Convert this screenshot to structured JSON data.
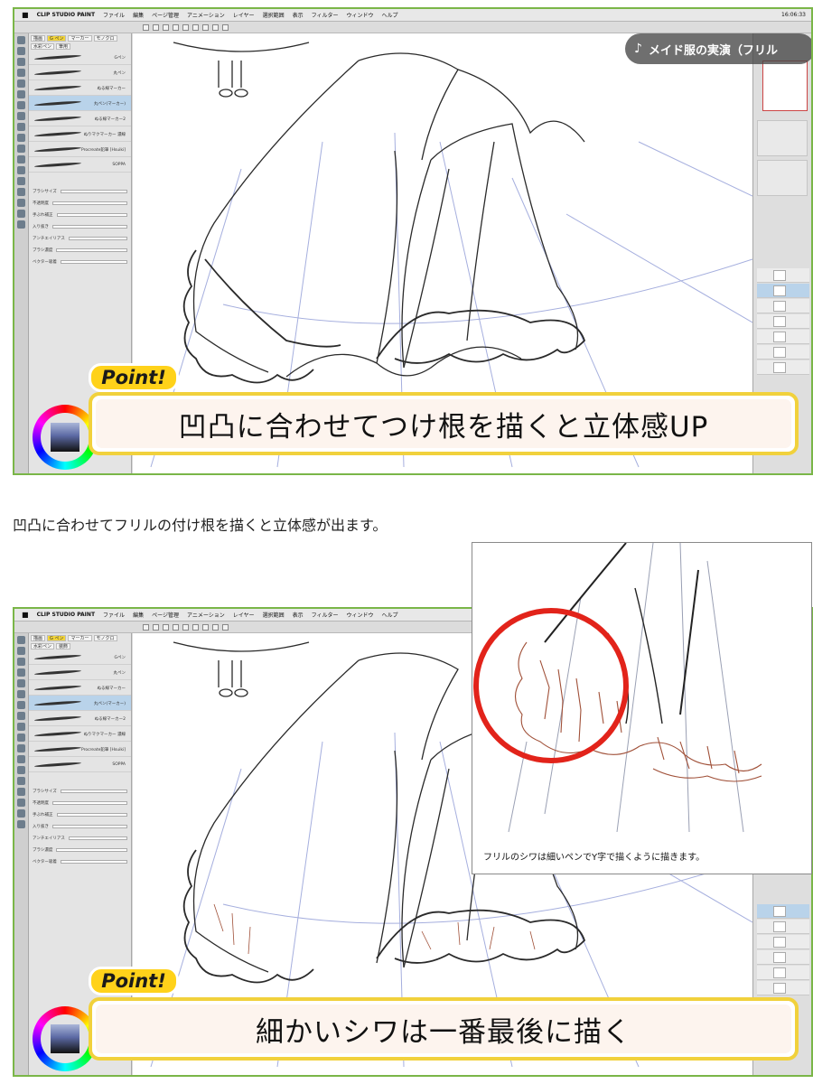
{
  "app": {
    "name": "CLIP STUDIO PAINT",
    "menu": [
      "ファイル",
      "編集",
      "ページ管理",
      "アニメーション",
      "レイヤー",
      "選択範囲",
      "表示",
      "フィルター",
      "ウィンドウ",
      "ヘルプ"
    ],
    "clock": "16:06:33"
  },
  "subtool": {
    "tabs": [
      "描画",
      "G ペン",
      "マーカー",
      "モノクロ",
      "水彩ペン",
      "筆用",
      "装飾"
    ],
    "brushes": [
      "Gペン",
      "丸ペン",
      "ぬる線マーカー",
      "丸ペン(マーカー)",
      "ぬる線マーカー2",
      "ぬりマクマーカー 濃線",
      "Procreate鉛筆 [Hsuiki]",
      "SOPPA"
    ],
    "selected_index": 3,
    "prop_labels": [
      "ブラシサイズ",
      "不透明度",
      "手ぶれ補正",
      "入り抜き",
      "アンチエイリアス",
      "ブラシ濃度",
      "ベクター吸着"
    ]
  },
  "video_title": "メイド服の実演（フリル",
  "point_label": "Point!",
  "caption_1": "凹凸に合わせてつけ根を描くと立体感UP",
  "caption_2": "細かいシワは一番最後に描く",
  "body_text": "凹凸に合わせてフリルの付け根を描くと立体感が出ます。",
  "zoom_caption": "フリルのシワは細いペンでY字で描くように描きます。",
  "colors": {
    "frame": "#7ab648",
    "point_bg": "#ffd21a",
    "caption_border": "#f1d13c",
    "caption_fill": "#fdf4ee",
    "circle": "#e2231a",
    "sketch_line": "#8f9bd6",
    "ink_line": "#2a2a2a",
    "ruffle_brown": "#a05038"
  }
}
